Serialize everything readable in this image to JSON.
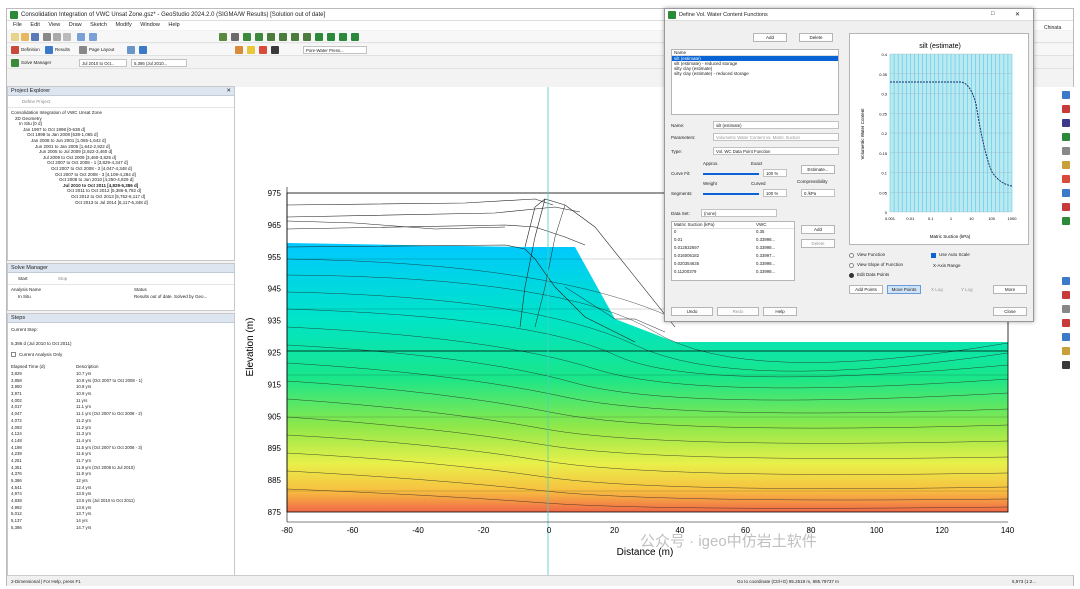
{
  "window": {
    "title": "Consolidation Integration of VWC Unsat Zone.gsz* - GeoStudio 2024.2.0 (SIGMA/W Results) [Solution out of date]"
  },
  "menu": [
    "File",
    "Edit",
    "View",
    "Draw",
    "Sketch",
    "Modify",
    "Window",
    "Help"
  ],
  "toolbar": {
    "definition": "Definition",
    "results": "Results",
    "page_layout": "Page Layout",
    "pore_water": "Pore-Water Press..."
  },
  "toolbar2": {
    "solve_manager": "Solve Manager",
    "step_range": "Jul 2010 to Oct...",
    "time_value": "5,386 (Jul 2010..."
  },
  "project_explorer": {
    "title": "Project Explorer",
    "define_project": "Define Project",
    "tree": [
      "Consolidation Integration of VWC Unsat Zone",
      "2D Geometry",
      "In Situ [0 d]",
      "Jan 1997 to Oct 1998 [0-638 d]",
      "Oct 1998 to Jan 2008 [638-1,065 d]",
      "Jan 2008 to Jun 2001 [1,065-1,642 d]",
      "Jun 2001 to Jan 2005 [1,642-2,922 d]",
      "Jun 2005 to Jul 2009 [2,922-3,460 d]",
      "Jul 2009 to Oct 2009 [3,460-3,825 d]",
      "Oct 2007 to Oct 2008 - 1 [3,829-4,347 d]",
      "Oct 2007 to Oct 2008 - 2 [4,047-4,348 d]",
      "Oct 2007 to Oct 2008 - 3 [4,109-4,284 d]",
      "Oct 2008 to Jun 2010 [4,250-4,829 d]",
      "Jul 2010 to Oct 2011 [4,829-5,386 d]",
      "Oct 2011 to Oct 2012 [5,386-5,782 d]",
      "Oct 2012 to Oct 2013 [5,752-6,117 d]",
      "Oct 2013 to Jul 2014 [6,117-6,348 d]"
    ]
  },
  "solve_manager": {
    "title": "Solve Manager",
    "start": "Start",
    "stop": "Stop",
    "col1": "Analysis Name",
    "col2": "Status",
    "row_name": "In Situ",
    "row_status": "Results out of date. Solved by Geo..."
  },
  "steps": {
    "title": "Steps",
    "current": "Current Step:",
    "current_value": "5,386 d (Jul 2010 to Oct 2011)",
    "checkbox": "Current Analysis Only",
    "col1": "Elapsed Time (d)",
    "col2": "Description",
    "rows": [
      [
        "3,829",
        "10.7 yrs"
      ],
      [
        "3,858",
        "10.8 yrs (Oct 2007 to Oct 2008 - 1)"
      ],
      [
        "3,950",
        "10.8 yrs"
      ],
      [
        "3,971",
        "10.9 yrs"
      ],
      [
        "4,002",
        "11 yrs"
      ],
      [
        "4,017",
        "11.1 yrs"
      ],
      [
        "4,047",
        "11.1 yrs (Oct 2007 to Oct 2008 - 2)"
      ],
      [
        "4,072",
        "11.2 yrs"
      ],
      [
        "4,093",
        "11.2 yrs"
      ],
      [
        "4,124",
        "11.3 yrs"
      ],
      [
        "4,148",
        "11.4 yrs"
      ],
      [
        "4,198",
        "11.5 yrs (Oct 2007 to Oct 2008 - 3)"
      ],
      [
        "4,239",
        "11.6 yrs"
      ],
      [
        "4,251",
        "11.7 yrs"
      ],
      [
        "4,351",
        "11.8 yrs (Oct 2008 to Jul 2010)"
      ],
      [
        "4,376",
        "11.9 yrs"
      ],
      [
        "5,386",
        "12 yrs"
      ],
      [
        "4,541",
        "12.4 yrs"
      ],
      [
        "4,974",
        "13.5 yrs"
      ],
      [
        "4,838",
        "13.5 yrs (Jul 2010 to Oct 2011)"
      ],
      [
        "4,992",
        "13.6 yrs"
      ],
      [
        "5,012",
        "13.7 yrs"
      ],
      [
        "5,137",
        "14 yrs"
      ],
      [
        "5,386",
        "14.7 yrs"
      ]
    ]
  },
  "plot": {
    "ylabel": "Elevation (m)",
    "xlabel": "Distance (m)",
    "yticks": [
      "975",
      "965",
      "955",
      "945",
      "935",
      "925",
      "915",
      "905",
      "895",
      "885",
      "875"
    ],
    "xticks": [
      "-80",
      "-60",
      "-40",
      "-20",
      "0",
      "20",
      "40",
      "60",
      "80",
      "100",
      "120",
      "140"
    ]
  },
  "dialog": {
    "title": "Define Vol. Water Content Functions",
    "add": "Add",
    "delete": "Delete",
    "list_header": "Name",
    "items": [
      "silt (estimate)",
      "silt (estimate) - reduced storage",
      "silty clay (estimate)",
      "silty clay (estimate) - reduced storage"
    ],
    "name_label": "Name:",
    "name_value": "silt (estimate)",
    "parameters_label": "Parameters:",
    "parameters_value": "Volumetric Water Content vs. Matric Suction",
    "type_label": "Type:",
    "type_value": "Vol. WC Data Point Function",
    "approx": "Approx.",
    "exact": "Exact",
    "curvefit_label": "Curve Fit:",
    "curvefit_value": "100 %",
    "weight": "Weight",
    "curved": "Curved",
    "segments_label": "Segments:",
    "segments_value": "100 %",
    "estimate_btn": "Estimate...",
    "compressibility_label": "Compressibility",
    "compressibility_value": "0 /kPa",
    "dataset_label": "Data Set:",
    "dataset_value": "(none)",
    "table_col1": "Matric Suction (kPa)",
    "table_col2": "VWC",
    "table_rows": [
      [
        "0",
        "0.35"
      ],
      [
        "0.01",
        "0.33998..."
      ],
      [
        "0.012632697",
        "0.33998..."
      ],
      [
        "0.016006182",
        "0.33997..."
      ],
      [
        "0.020354635",
        "0.33998..."
      ],
      [
        "0.11200379",
        "0.33998..."
      ]
    ],
    "add_row": "Add",
    "delete_row": "Delete",
    "chart_title": "silt (estimate)",
    "chart_ylabel": "Volumetric Water Content",
    "chart_xlabel": "Matric Suction (kPa)",
    "chart_yticks": [
      "0.4",
      "0.35",
      "0.3",
      "0.25",
      "0.2",
      "0.15",
      "0.1",
      "0.05",
      "0"
    ],
    "chart_xticks": [
      "0.001",
      "0.01",
      "0.1",
      "1",
      "10",
      "100",
      "1000"
    ],
    "view_function": "View Function",
    "view_slope": "View Slope of Function",
    "edit_points": "Edit Data Points",
    "auto_scale": "Use Auto Scale",
    "x_axis_range": "X-Axis Range",
    "add_points": "Add Points",
    "move_points": "Move Points",
    "x_log": "X Log",
    "y_log": "Y Log",
    "more": "More",
    "undo": "Undo",
    "redo": "Redo",
    "help": "Help",
    "close": "Close"
  },
  "status": {
    "left": "2-Dimensional  |  For Help, press F1",
    "coords": "Go to coordinate (Ctrl+G)  95.2519 m, 885.79737 m",
    "zoom": "5,973 (1:2..."
  },
  "watermark": "公众号 · igeo中仿岩土软件",
  "corner_text": "Chinata"
}
